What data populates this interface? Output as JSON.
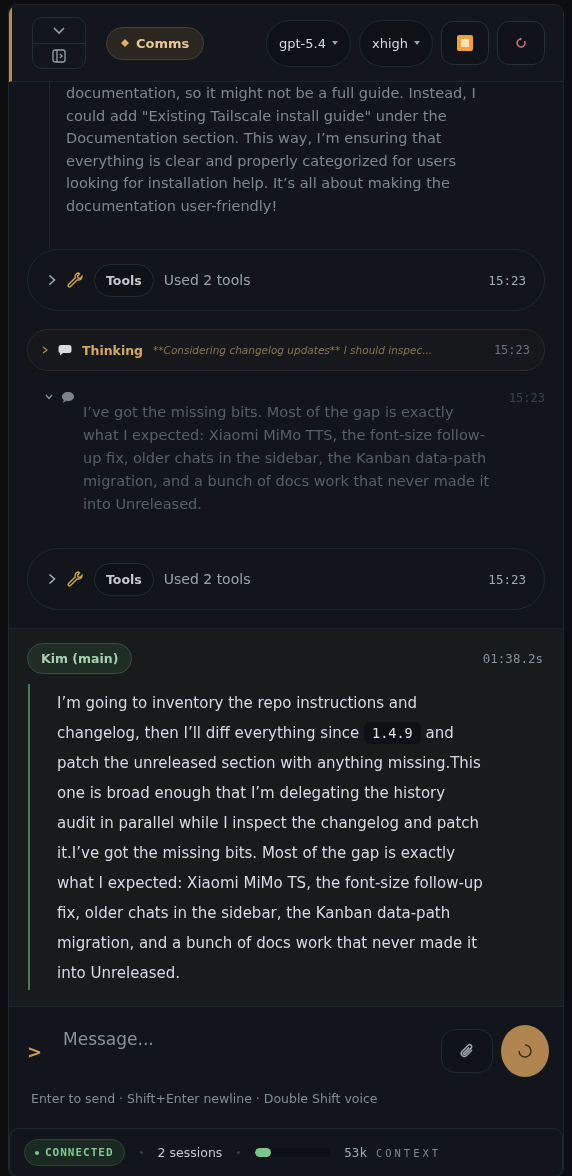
{
  "header": {
    "channel": "Comms",
    "model": "gpt-5.4",
    "effort": "xhigh"
  },
  "feed": [
    {
      "kind": "reasoning",
      "text": "documentation, so it might not be a full guide. Instead, I could add \"Existing Tailscale install guide\" under the Documentation section. This way, I’m ensuring that everything is clear and properly categorized for users looking for installation help. It’s all about making the documentation user-friendly!"
    },
    {
      "kind": "tools",
      "expanded": false,
      "label": "Tools",
      "summary": "Used 2 tools",
      "time": "15:23"
    },
    {
      "kind": "thinking",
      "expanded": false,
      "label": "Thinking",
      "preview": "**Considering changelog updates** I should inspec...",
      "time": "15:23"
    },
    {
      "kind": "message",
      "expanded": true,
      "text": "I’ve got the missing bits. Most of the gap is exactly what I expected: Xiaomi MiMo TTS, the font-size follow-up fix, older chats in the sidebar, the Kanban data-path migration, and a bunch of docs work that never made it into Unreleased.",
      "time": "15:23"
    },
    {
      "kind": "tools",
      "expanded": false,
      "label": "Tools",
      "summary": "Used 2 tools",
      "time": "15:23"
    }
  ],
  "agent": {
    "name": "Kim (main)",
    "elapsed": "01:38.2s",
    "text_before": "I’m going to inventory the repo instructions and changelog, then I’ll diff everything since",
    "code": "1.4.9",
    "text_after": "and patch the unreleased section with anything missing.This one is broad enough that I’m delegating the history audit in parallel while I inspect the changelog and patch it.I’ve got the missing bits. Most of the gap is exactly what I expected: Xiaomi MiMo TS, the font-size follow-up fix, older chats in the sidebar, the Kanban data-path migration, and a bunch of docs work that never made it into Unreleased."
  },
  "composer": {
    "prompt": ">",
    "placeholder": "Message...",
    "hint": "Enter to send · Shift+Enter newline · Double Shift voice"
  },
  "status": {
    "connected": true,
    "label": "CONNECTED",
    "sessions": "2 sessions",
    "level": 0.2,
    "tokens": "53k",
    "context_label": "CONTEXT"
  }
}
